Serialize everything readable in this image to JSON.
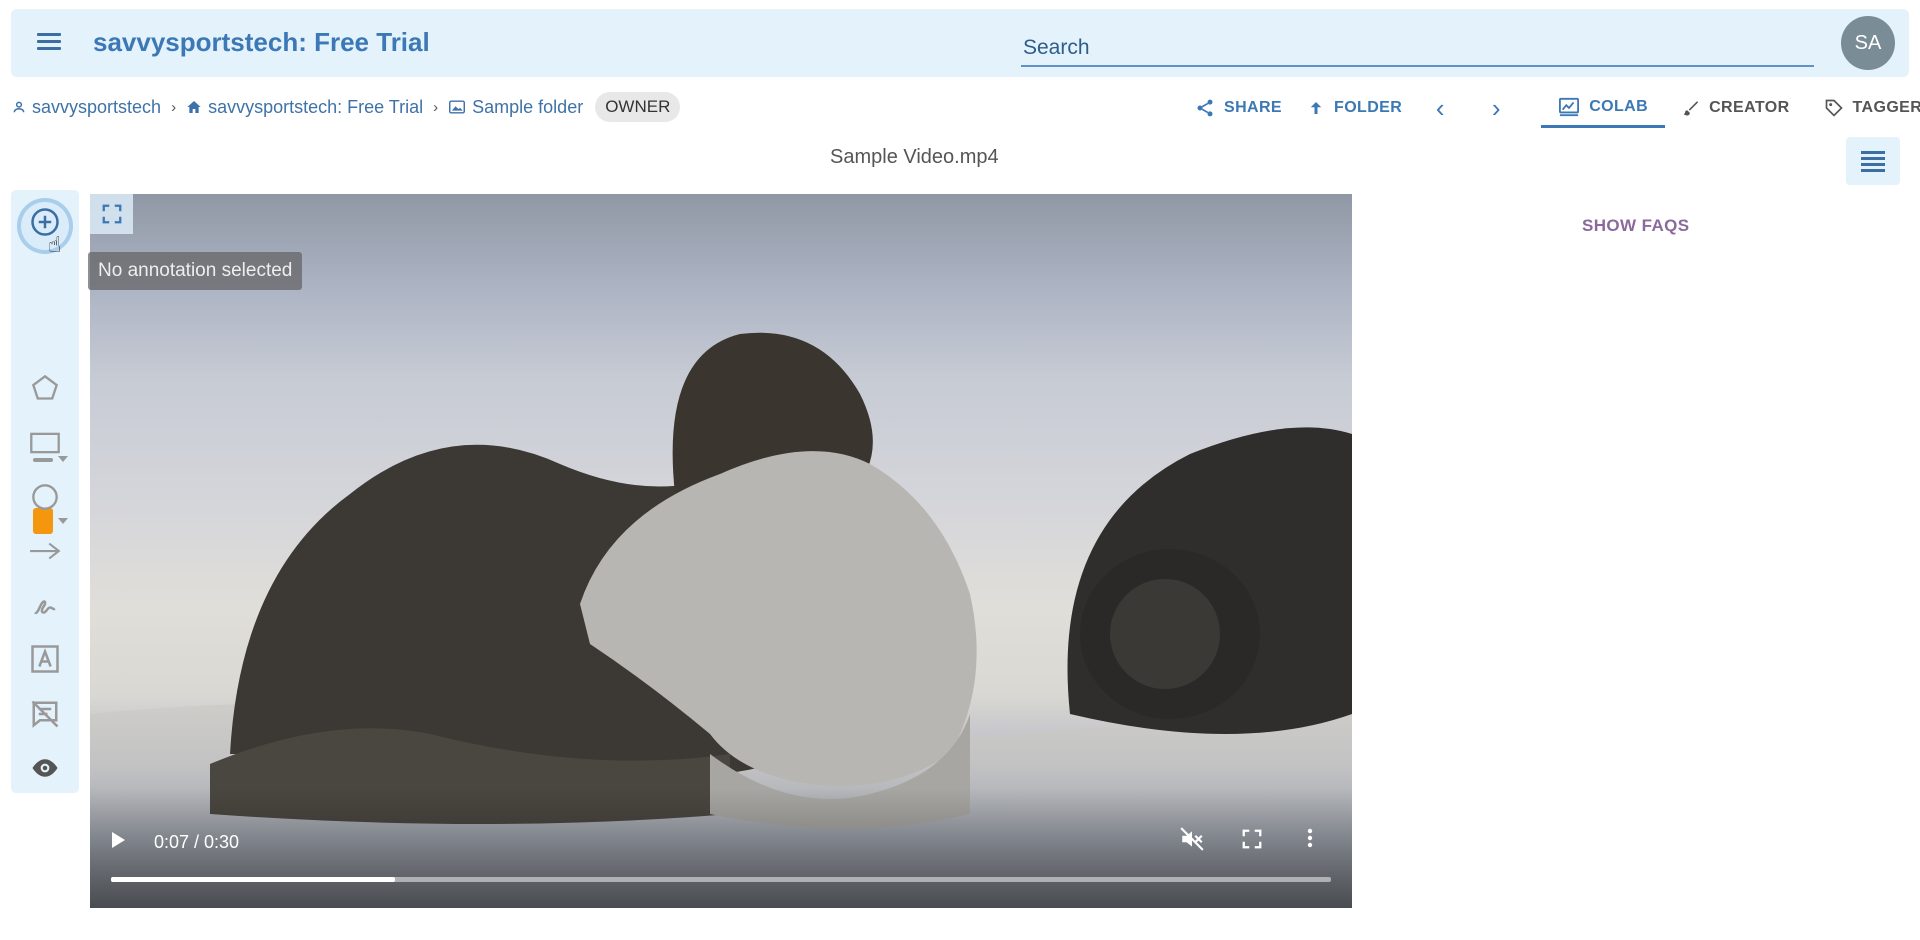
{
  "header": {
    "app_title": "savvysportstech: Free Trial",
    "search_placeholder": "Search",
    "avatar_initials": "SA"
  },
  "breadcrumb": {
    "items": [
      {
        "label": "savvysportstech",
        "icon": "person-icon"
      },
      {
        "label": "savvysportstech: Free Trial",
        "icon": "home-icon"
      },
      {
        "label": "Sample folder",
        "icon": "folder-image-icon"
      }
    ],
    "separator": "›",
    "role_badge": "OWNER"
  },
  "actions": {
    "share": "SHARE",
    "folder": "FOLDER",
    "prev": "‹",
    "next": "›"
  },
  "tabs": [
    {
      "label": "COLAB",
      "icon": "draw-icon",
      "active": true
    },
    {
      "label": "CREATOR",
      "icon": "brush-icon",
      "active": false
    },
    {
      "label": "TAGGER",
      "icon": "tag-icon",
      "active": false
    }
  ],
  "file": {
    "title": "Sample Video.mp4"
  },
  "annotation": {
    "tooltip": "No annotation selected",
    "color": "#f5960f"
  },
  "video": {
    "time": "0:07 / 0:30",
    "progress_fraction": 0.233
  },
  "side_panel": {
    "show_faqs": "SHOW FAQS"
  },
  "colors": {
    "accent": "#3b78b5",
    "header_bg": "#e3f2fb",
    "faq": "#8a6a9c"
  }
}
